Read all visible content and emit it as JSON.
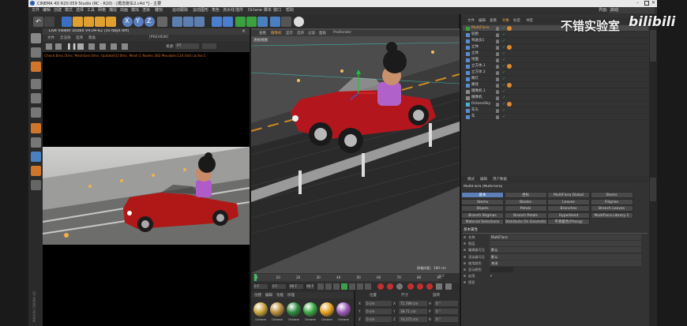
{
  "title_bar": {
    "title": "CINEMA 4D R20.059 Studio (RC - R20) - [概念跑车2.c4d *] - 主要"
  },
  "menu": {
    "items": [
      "文件",
      "编辑",
      "创建",
      "模式",
      "选择",
      "工具",
      "网格",
      "捕捉",
      "动画",
      "模拟",
      "渲染",
      "雕刻",
      "运动跟踪",
      "运动图形",
      "角色",
      "流水线",
      "插件",
      "Octane",
      "脚本",
      "窗口",
      "帮助"
    ]
  },
  "interface": {
    "label": "界面:",
    "value": "启动"
  },
  "axis_buttons": [
    "X",
    "Y",
    "Z"
  ],
  "live_viewer": {
    "title": "Live Viewer Studio V4.04-R2 (30 days left)",
    "menu": [
      "文件",
      "云渲染",
      "选项",
      "帮助",
      "[PREVIEW]"
    ],
    "mode_label": "来源:",
    "mode_value": "PT",
    "status": "Check:8ms./2ms. MeshGen:0ms. Update[G]:0ms. Mesh:1 Nodes:383 Movable:124 0x0:cache:1"
  },
  "viewport": {
    "menu": [
      "查看",
      "摄像机",
      "显示",
      "选项",
      "过滤",
      "面板",
      "ProRender"
    ],
    "camera_label": "透视视图",
    "grid_label": "网格间距：100 cm"
  },
  "timeline": {
    "ticks": [
      "0",
      "10",
      "20",
      "30",
      "40",
      "50",
      "60",
      "70",
      "80",
      "90"
    ],
    "start_frame": "0 F",
    "current_frame": "0 F",
    "end_frame": "90 F",
    "end_frame2": "90 F",
    "frame_indicator": "0 F"
  },
  "object_manager": {
    "menu": [
      "文件",
      "编辑",
      "查看",
      "对象",
      "标签",
      "书签"
    ],
    "objects": [
      {
        "name": "MultiFlora",
        "selected": true
      },
      {
        "name": "轮胎"
      },
      {
        "name": "驾驶员1"
      },
      {
        "name": "立体"
      },
      {
        "name": "立体"
      },
      {
        "name": "地面"
      },
      {
        "name": "立方体.1"
      },
      {
        "name": "立方体.2"
      },
      {
        "name": "路灯"
      },
      {
        "name": "路径"
      },
      {
        "name": "摄像机.1"
      },
      {
        "name": "摄像机"
      },
      {
        "name": "OctaneSky"
      },
      {
        "name": "车头"
      },
      {
        "name": "车"
      }
    ]
  },
  "attributes": {
    "menu": [
      "模式",
      "编辑",
      "用户数据"
    ],
    "object_title": "MultiFlora [MultiFlora]",
    "tabs": [
      [
        "基本",
        "坐标",
        "MultiFlora Global",
        "Stems"
      ],
      [
        "Stems",
        "Blades",
        "Leaves",
        "Filigrias"
      ],
      [
        "Stipels",
        "Petals",
        "Branches",
        "Branch Leaves"
      ],
      [
        "Branch Stigmas",
        "Branch Petals",
        "Hyperbloid",
        "MultiFlora Library 1"
      ],
      [
        "Material Selections",
        "Distribute On Geometry",
        "平滑着色(Phong)",
        ""
      ]
    ],
    "section_title": "基本属性",
    "fields": [
      {
        "label": "名称",
        "value": "MultiFlora"
      },
      {
        "label": "图层",
        "value": ""
      },
      {
        "label": "编辑器可见",
        "value": "默认"
      },
      {
        "label": "渲染器可见",
        "value": "默认"
      },
      {
        "label": "使用颜色",
        "value": "关闭"
      },
      {
        "label": "显示颜色",
        "value": ""
      },
      {
        "label": "启用",
        "value": "✓"
      },
      {
        "label": "透显",
        "value": ""
      }
    ]
  },
  "materials": {
    "menu": [
      "创建",
      "编辑",
      "功能",
      "纹理"
    ],
    "items": [
      {
        "name": "Octane",
        "color": "#c9a23a"
      },
      {
        "name": "Octane",
        "color": "#b98b3a"
      },
      {
        "name": "Octane",
        "color": "#2c8a3c"
      },
      {
        "name": "Octane",
        "color": "#3aa844"
      },
      {
        "name": "Octane",
        "color": "#e8a21e"
      },
      {
        "name": "Octane",
        "color": "#9b5ab8"
      }
    ]
  },
  "coordinates": {
    "headers": [
      "位置",
      "尺寸",
      "旋转"
    ],
    "rows": [
      {
        "axis": "X",
        "pos": "0 cm",
        "size": "71.789 cm",
        "rot": "H",
        "rot_val": "0 °"
      },
      {
        "axis": "Y",
        "pos": "0 cm",
        "size": "38.71 cm",
        "rot": "P",
        "rot_val": "0 °"
      },
      {
        "axis": "Z",
        "pos": "0 cm",
        "size": "74.271 cm",
        "rot": "B",
        "rot_val": "0 °"
      }
    ]
  },
  "watermark": {
    "text": "不错实验室",
    "logo": "bilibili"
  },
  "left_sidebar_label": "MAXON CINEMA 4D"
}
